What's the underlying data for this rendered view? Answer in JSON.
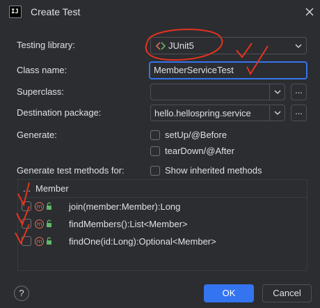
{
  "window": {
    "title": "Create Test"
  },
  "form": {
    "testing_library_label": "Testing library:",
    "testing_library_value": "JUnit5",
    "class_name_label": "Class name:",
    "class_name_value": "MemberServiceTest",
    "superclass_label": "Superclass:",
    "superclass_value": "",
    "superclass_browse": "...",
    "destination_label": "Destination package:",
    "destination_value": "hello.hellospring.service",
    "destination_browse": "...",
    "generate_label": "Generate:",
    "setup_label": "setUp/@Before",
    "setup_checked": false,
    "teardown_label": "tearDown/@After",
    "teardown_checked": false,
    "methods_label": "Generate test methods for:",
    "inherited_label": "Show inherited methods",
    "inherited_checked": false
  },
  "table": {
    "header": "Member",
    "header_dots": "...",
    "rows": [
      {
        "method": "join(member:Member):Long",
        "checked": false
      },
      {
        "method": "findMembers():List<Member>",
        "checked": false
      },
      {
        "method": "findOne(id:Long):Optional<Member>",
        "checked": false
      }
    ],
    "method_icon_letter": "m"
  },
  "footer": {
    "help": "?",
    "ok_label": "OK",
    "cancel_label": "Cancel"
  },
  "icons": {
    "app": "intellij-icon",
    "close": "close-icon",
    "dropdown": "chevron-down-icon",
    "junit": "junit-icon",
    "method": "method-icon",
    "visibility": "public-lock-icon"
  },
  "colors": {
    "background": "#2b2d30",
    "accent": "#3574f0",
    "annotation": "#e8321f"
  }
}
